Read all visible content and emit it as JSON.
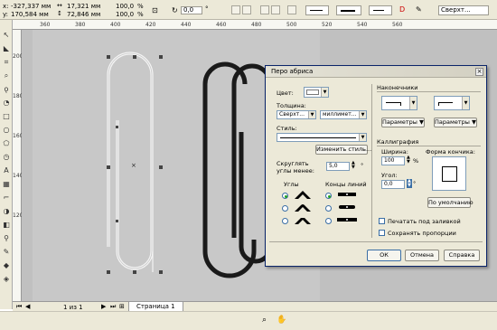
{
  "propbar": {
    "x_label": "x:",
    "x_value": "-327,337 мм",
    "y_label": "y:",
    "y_value": "170,584 мм",
    "w_value": "17,321 мм",
    "h_value": "72,846 мм",
    "sx_value": "100,0",
    "sy_value": "100,0",
    "pct": "%",
    "angle_value": "0,0",
    "deg": "°",
    "outline_width": "Сверхт..."
  },
  "ruler": {
    "h_ticks": [
      "360",
      "380",
      "400",
      "420",
      "440",
      "460",
      "480",
      "500",
      "520",
      "540",
      "560"
    ],
    "v_ticks": [
      "200",
      "180",
      "160",
      "140",
      "120"
    ]
  },
  "pagebar": {
    "counter": "1 из 1",
    "tab": "Страница 1"
  },
  "dialog": {
    "title": "Перо абриса",
    "color_label": "Цвет:",
    "width_label": "Толщина:",
    "width_value": "Сверхт...",
    "width_units": "миллимет...",
    "style_label": "Стиль:",
    "edit_style_button": "Изменить стиль...",
    "round_label_1": "Скруглять",
    "round_label_2": "углы менее:",
    "round_value": "5,0",
    "corners_label": "Углы",
    "caps_label": "Концы линий",
    "arrows_label": "Наконечники",
    "params_left": "Параметры",
    "params_right": "Параметры",
    "calligraphy_label": "Каллиграфия",
    "stretch_label": "Ширина:",
    "stretch_value": "100",
    "pct": "%",
    "nib_shape_label": "Форма кончика:",
    "angle_label": "Угол:",
    "angle_value": "0,0",
    "default_button": "По умолчанию",
    "behind_fill_label": "Печатать под заливкой",
    "scale_label": "Сохранять пропорции",
    "ok_button": "ОК",
    "cancel_button": "Отмена",
    "help_button": "Справка"
  }
}
